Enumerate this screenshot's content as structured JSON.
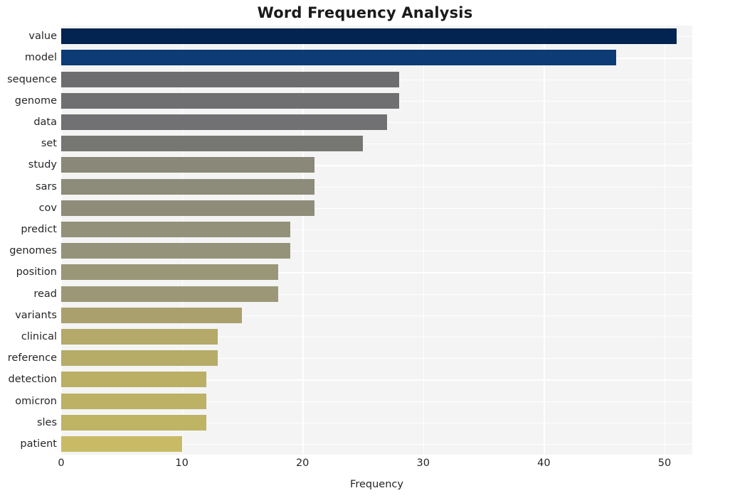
{
  "chart_data": {
    "type": "bar",
    "orientation": "horizontal",
    "title": "Word Frequency Analysis",
    "xlabel": "Frequency",
    "ylabel": "",
    "categories": [
      "value",
      "model",
      "sequence",
      "genome",
      "data",
      "set",
      "study",
      "sars",
      "cov",
      "predict",
      "genomes",
      "position",
      "read",
      "variants",
      "clinical",
      "reference",
      "detection",
      "omicron",
      "sles",
      "patient"
    ],
    "values": [
      51,
      46,
      28,
      28,
      27,
      25,
      21,
      21,
      21,
      19,
      19,
      18,
      18,
      15,
      13,
      13,
      12,
      12,
      12,
      10
    ],
    "bar_colors": [
      "#032450",
      "#0c3b76",
      "#6d6d70",
      "#6f6f71",
      "#717173",
      "#767672",
      "#8a8878",
      "#8d8b79",
      "#8f8d7a",
      "#94917a",
      "#96937b",
      "#9a9678",
      "#9c9877",
      "#a9a06e",
      "#b4a968",
      "#b6ab67",
      "#bbaf65",
      "#bdb165",
      "#bfb364",
      "#c9bb66"
    ],
    "xlim": [
      0,
      52.3
    ],
    "xticks": [
      0,
      10,
      20,
      30,
      40,
      50
    ],
    "xtick_labels": [
      "0",
      "10",
      "20",
      "30",
      "40",
      "50"
    ],
    "grid": true,
    "grid_color": "#ffffff",
    "plot_background": "#f4f4f4",
    "figure_background": "#ffffff",
    "legend": null,
    "style": "seaborn-darkgrid"
  }
}
